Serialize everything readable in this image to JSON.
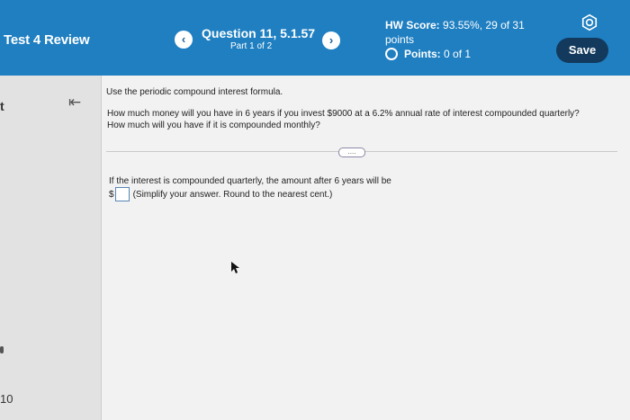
{
  "header": {
    "title": "Test 4 Review",
    "question_title": "Question 11, 5.1.57",
    "question_part": "Part 1 of 2",
    "prev_icon": "chevron-left",
    "next_icon": "chevron-right",
    "hw_score_label": "HW Score:",
    "hw_score_value": "93.55%, 29 of 31",
    "hw_score_unit": "points",
    "points_label": "Points:",
    "points_value": "0 of 1",
    "settings_icon": "gear-icon",
    "save_label": "Save"
  },
  "sidebar": {
    "mark": "t",
    "number": "10",
    "collapse_icon": "collapse-left-icon"
  },
  "question": {
    "instruction": "Use the periodic compound interest formula.",
    "text_line1": "How much money will you have in 6 years if you invest $9000 at a 6.2% annual rate of interest compounded quarterly?",
    "text_line2": "How much will you have if it is compounded monthly?",
    "more_button": "....",
    "prompt": "If the interest is compounded quarterly, the amount after 6 years will be",
    "answer_prefix": "$",
    "answer_value": "",
    "answer_hint": "(Simplify your answer. Round to the nearest cent.)"
  },
  "colors": {
    "header_bg": "#1f7fc1",
    "save_bg": "#133a5c",
    "answer_border": "#5a86b3"
  }
}
